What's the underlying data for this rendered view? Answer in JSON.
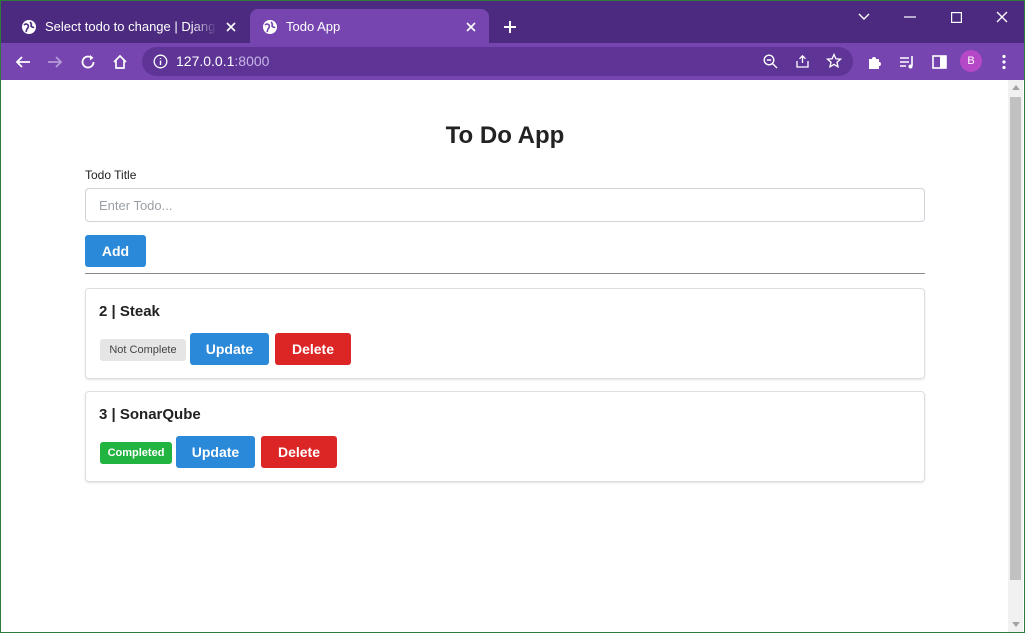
{
  "browser": {
    "tabs": [
      {
        "title": "Select todo to change | Django site admin",
        "active": false
      },
      {
        "title": "Todo App",
        "active": true
      }
    ],
    "address": {
      "host": "127.0.0.1",
      "port": ":8000"
    },
    "profile_initial": "B",
    "colors": {
      "frame": "#4b2a80",
      "toolbar": "#7645b0",
      "omnibox": "#5e3596"
    }
  },
  "app": {
    "title": "To Do App",
    "form": {
      "label": "Todo Title",
      "placeholder": "Enter Todo...",
      "value": "",
      "add_label": "Add"
    },
    "todos": [
      {
        "heading": "2 | Steak",
        "status": "Not Complete",
        "update_label": "Update",
        "delete_label": "Delete"
      },
      {
        "heading": "3 | SonarQube",
        "status": "Completed",
        "update_label": "Update",
        "delete_label": "Delete"
      }
    ],
    "colors": {
      "primary": "#2a89d8",
      "danger": "#dc2626",
      "success": "#21b441",
      "neutral": "#e5e5e5"
    }
  }
}
